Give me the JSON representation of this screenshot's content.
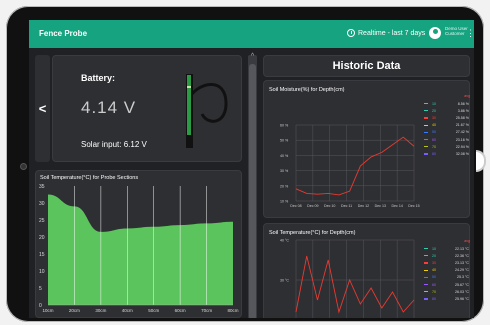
{
  "header": {
    "title": "Fence Probe",
    "realtime_label": "Realtime - last 7 days",
    "user_name": "Demo User",
    "user_role": "Customer"
  },
  "nav": {
    "back_icon": "<"
  },
  "battery": {
    "label": "Battery:",
    "value": "4.14 V",
    "solar_input": "Solar input: 6.12 V"
  },
  "historic": {
    "title": "Historic Data"
  },
  "colors": {
    "brand": "#16a37f",
    "fill_green": "#5cc45c",
    "line_red": "#e83a30",
    "avg_red": "#ff4b4b"
  },
  "soil_temp_sections": {
    "title": "Soil Temperature(°C) for Probe Sections"
  },
  "moisture_chart": {
    "title": "Soil Moisture(%) for Depth(cm)",
    "avg_label": "avg"
  },
  "temp_depth_chart": {
    "title": "Soil Temperature(°C) for Depth(cm)",
    "avg_label": "avg"
  },
  "chart_data": [
    {
      "type": "area",
      "title": "Soil Temperature(°C) for Probe Sections",
      "x": [
        "10cm",
        "20cm",
        "30cm",
        "40cm",
        "50cm",
        "60cm",
        "70cm",
        "80cm"
      ],
      "y_ticks": [
        "35",
        "30",
        "25",
        "20",
        "15",
        "10",
        "5",
        "0"
      ],
      "ylim": [
        0,
        35
      ],
      "series": [
        {
          "values": [
            32.5,
            29,
            21.5,
            22.5,
            23,
            23.5,
            24,
            24.5
          ]
        }
      ],
      "grid": true
    },
    {
      "type": "line",
      "title": "Soil Moisture(%) for Depth(cm)",
      "x": [
        "Dec 08",
        "Dec 09",
        "Dec 10",
        "Dec 11",
        "Dec 12",
        "Dec 13",
        "Dec 14",
        "Dec 15"
      ],
      "y_ticks": [
        "60 %",
        "50 %",
        "40 %",
        "30 %",
        "20 %",
        "10 %"
      ],
      "ylim": [
        10,
        60
      ],
      "series": [
        {
          "values": [
            18,
            15,
            14.5,
            15,
            14,
            16.5,
            33,
            39,
            42,
            47,
            52,
            46
          ]
        }
      ],
      "legend": [
        {
          "depth": "10",
          "value": "8.56 %",
          "color": "#2fd0b0"
        },
        {
          "depth": "20",
          "value": "3.86 %",
          "color": "#2fd0b0"
        },
        {
          "depth": "30",
          "value": "25.58 %",
          "color": "#ff3b3b"
        },
        {
          "depth": "40",
          "value": "21.67 %",
          "color": "#f5d000"
        },
        {
          "depth": "50",
          "value": "27.42 %",
          "color": "#3a7bff"
        },
        {
          "depth": "60",
          "value": "23.16 %",
          "color": "#9b59ff"
        },
        {
          "depth": "70",
          "value": "22.94 %",
          "color": "#b8c21a"
        },
        {
          "depth": "80",
          "value": "32.08 %",
          "color": "#7a5cff"
        }
      ]
    },
    {
      "type": "line",
      "title": "Soil Temperature(°C) for Depth(cm)",
      "x": [],
      "y_ticks": [
        "40 °C",
        "30 °C",
        "20 °C"
      ],
      "ylim": [
        20,
        40
      ],
      "series": [
        {
          "values": [
            22,
            36,
            25,
            35,
            22,
            30,
            24,
            28,
            23,
            27,
            22,
            25
          ]
        }
      ],
      "legend": [
        {
          "depth": "10",
          "value": "22.13 °C",
          "color": "#2fd0b0"
        },
        {
          "depth": "20",
          "value": "22.36 °C",
          "color": "#2fd0b0"
        },
        {
          "depth": "30",
          "value": "23.13 °C",
          "color": "#ff3b3b"
        },
        {
          "depth": "40",
          "value": "24.29 °C",
          "color": "#f5d000"
        },
        {
          "depth": "50",
          "value": "25.3 °C",
          "color": "#3a7bff"
        },
        {
          "depth": "60",
          "value": "25.67 °C",
          "color": "#9b59ff"
        },
        {
          "depth": "70",
          "value": "26.03 °C",
          "color": "#b8c21a"
        },
        {
          "depth": "80",
          "value": "25.96 °C",
          "color": "#7a5cff"
        }
      ]
    }
  ]
}
